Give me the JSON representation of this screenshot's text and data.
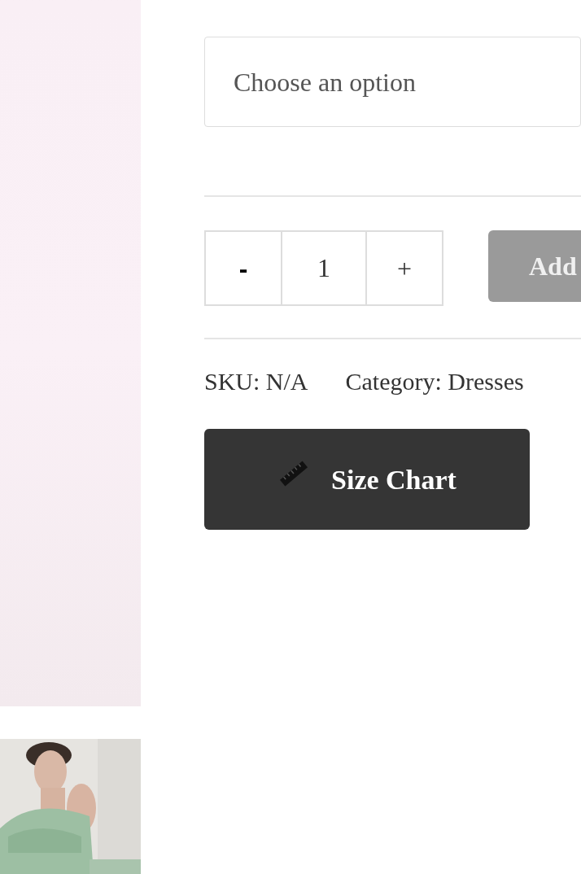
{
  "variation_select": {
    "placeholder": "Choose an option"
  },
  "quantity": {
    "minus": "-",
    "value": "1",
    "plus": "+"
  },
  "add_button": {
    "label": "Add",
    "disabled": true
  },
  "meta": {
    "sku": "SKU: N/A",
    "category": "Category: Dresses"
  },
  "size_chart_button": {
    "label": "Size Chart"
  }
}
